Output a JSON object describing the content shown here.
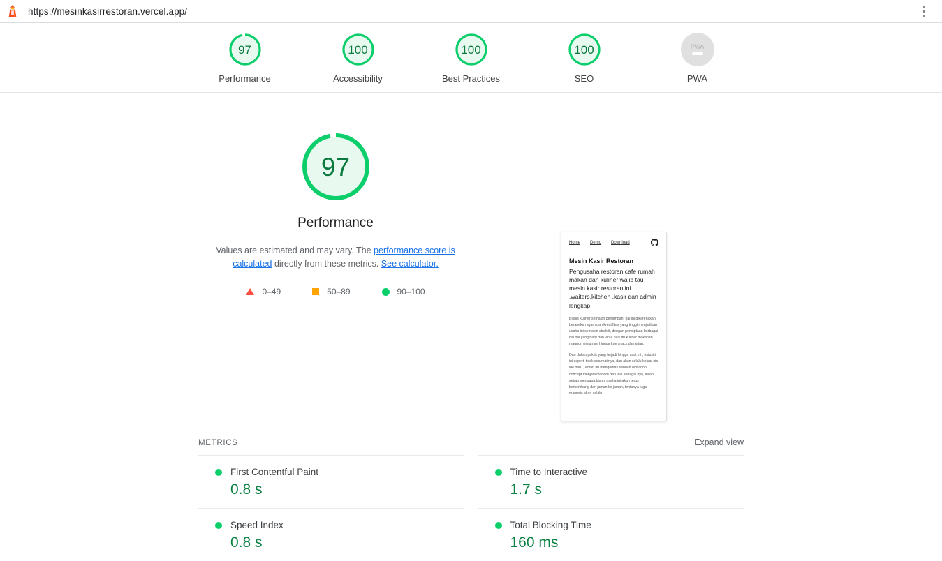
{
  "browser": {
    "url": "https://mesinkasirrestoran.vercel.app/",
    "lighthouse_icon": "lighthouse-icon",
    "menu_icon": "more-vertical-icon"
  },
  "scores": [
    {
      "value": "97",
      "label": "Performance",
      "percent": 97,
      "color": "#0cce6b"
    },
    {
      "value": "100",
      "label": "Accessibility",
      "percent": 100,
      "color": "#0cce6b"
    },
    {
      "value": "100",
      "label": "Best Practices",
      "percent": 100,
      "color": "#0cce6b"
    },
    {
      "value": "100",
      "label": "SEO",
      "percent": 100,
      "color": "#0cce6b"
    },
    {
      "value": "PWA",
      "label": "PWA",
      "percent": 0,
      "color": "#e0e0e0"
    }
  ],
  "hero": {
    "score": "97",
    "percent": 97,
    "title": "Performance",
    "desc_part1": "Values are estimated and may vary. The ",
    "link_calculated": "performance score is calculated",
    "desc_part2": " directly from these metrics. ",
    "link_see_calculator": "See calculator."
  },
  "legend": [
    {
      "shape": "triangle",
      "range": "0–49",
      "color": "#ff4e42"
    },
    {
      "shape": "square",
      "range": "50–89",
      "color": "#ffa400"
    },
    {
      "shape": "circle",
      "range": "90–100",
      "color": "#0cce6b"
    }
  ],
  "thumbnail": {
    "nav": [
      "Home",
      "Demo",
      "Download"
    ],
    "github_icon": "github-icon",
    "heading": "Mesin Kasir Restoran",
    "lead": "Pengusaha restoran cafe rumah makan dan kuliner wajib tau mesin kasir restoran ini ,waiters,kitchen ,kasir dan admin lengkap",
    "paragraph1": "Bisnis kuliner semakin bertambah, hal ini dikarenakan beraneka ragam dan kreatifitas yang tinggi menjadikan usaha ini semakin atraktif, dengan penciptaan berbagai hal hal yang baru dan viral, baik itu kuliner makanan maupun minuman hingga kue snack dan jajan.",
    "paragraph2": "Dan dalam paktik yang terjadi hingga saat ini , industri ini seperti tidak ada matinya, dan akan selalu keluar ide ide baru , entah itu mengemas sebuah oldschool concept menjadi modern dan lain sebagai nya, inilah sebab mengapa bisnis usaha ini akan terus berkembang dari jaman ke jaman, tentunya juga manusia akan selalu"
  },
  "metrics_section": {
    "title": "METRICS",
    "expand_view": "Expand view",
    "items": [
      {
        "name": "First Contentful Paint",
        "value": "0.8 s",
        "status_color": "#0cce6b"
      },
      {
        "name": "Time to Interactive",
        "value": "1.7 s",
        "status_color": "#0cce6b"
      },
      {
        "name": "Speed Index",
        "value": "0.8 s",
        "status_color": "#0cce6b"
      },
      {
        "name": "Total Blocking Time",
        "value": "160 ms",
        "status_color": "#0cce6b"
      }
    ]
  }
}
